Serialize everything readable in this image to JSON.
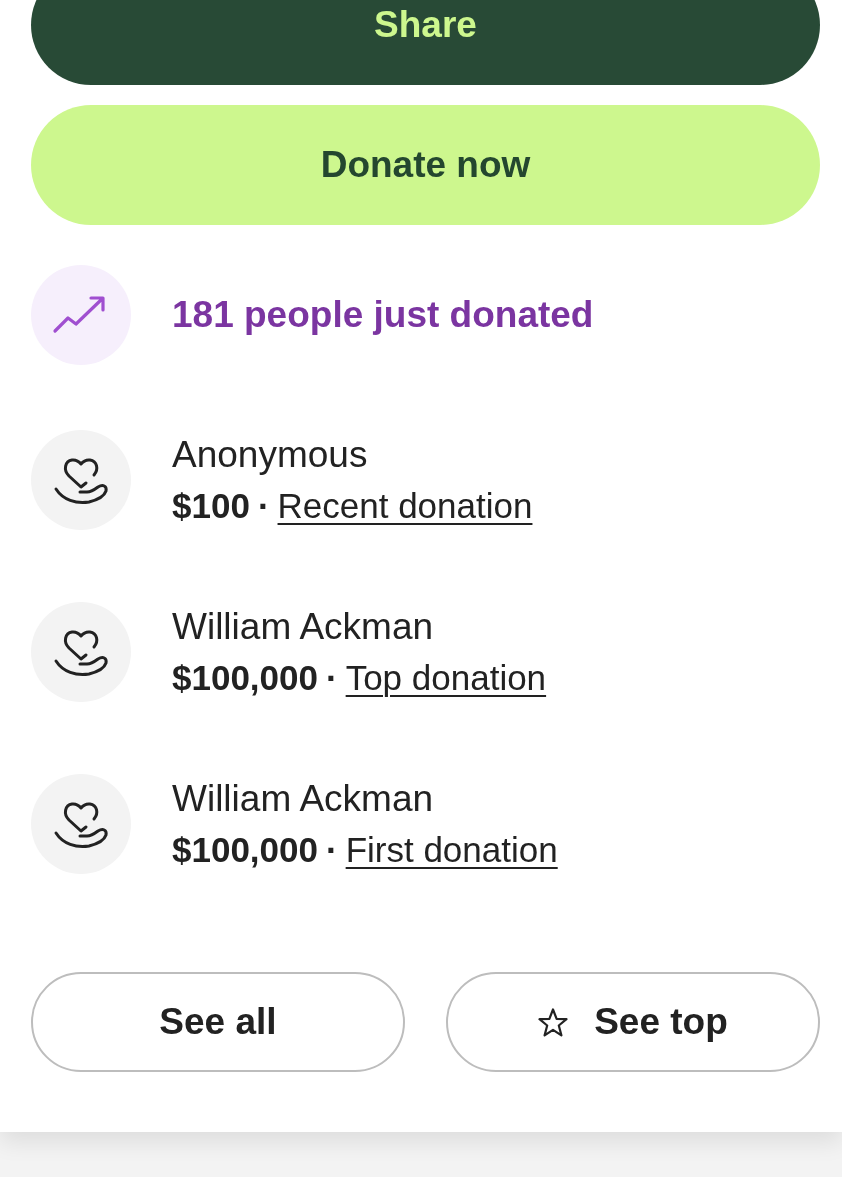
{
  "actions": [
    {
      "kind": "share",
      "label": "Share"
    },
    {
      "kind": "donate",
      "label": "Donate now"
    }
  ],
  "activity": {
    "text": "181 people just donated"
  },
  "donations": [
    {
      "name": "Anonymous",
      "amount": "$100",
      "separator": "·",
      "label": "Recent donation"
    },
    {
      "name": "William Ackman",
      "amount": "$100,000",
      "separator": "·",
      "label": "Top donation"
    },
    {
      "name": "William Ackman",
      "amount": "$100,000",
      "separator": "·",
      "label": "First donation"
    }
  ],
  "footer_buttons": [
    {
      "kind": "plain",
      "label": "See all"
    },
    {
      "kind": "star",
      "label": "See top"
    }
  ]
}
